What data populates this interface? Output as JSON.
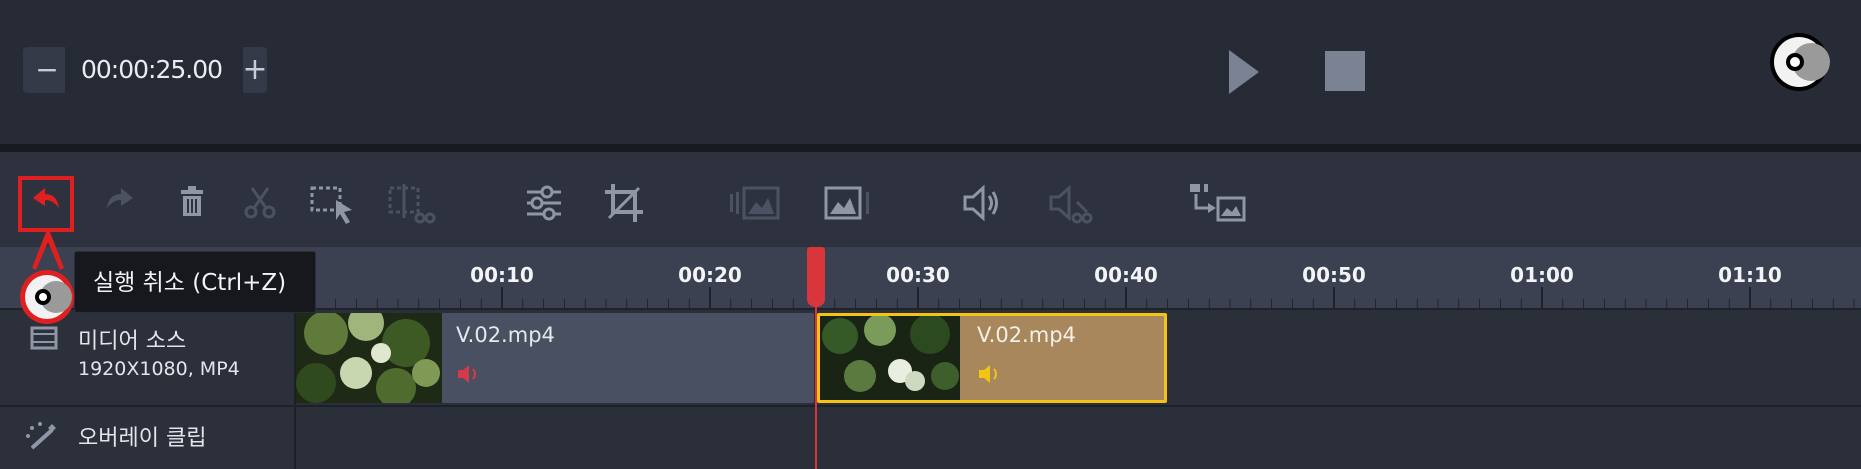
{
  "preview": {
    "time_value": "00:00:25.00",
    "minus_label": "−",
    "plus_label": "+"
  },
  "toolbar": {
    "undo_tooltip": "실행 취소 (Ctrl+Z)"
  },
  "ruler": {
    "ticks": [
      "00:10",
      "00:20",
      "00:30",
      "00:40",
      "00:50",
      "01:00",
      "01:10"
    ]
  },
  "tracks": {
    "video": {
      "label": "미디어 소스",
      "sub": "1920X1080, MP4",
      "clips": [
        {
          "name": "V.02.mp4",
          "selected": false
        },
        {
          "name": "V.02.mp4",
          "selected": true
        }
      ]
    },
    "overlay": {
      "label": "오버레이 클립"
    }
  },
  "colors": {
    "accent_red": "#e02020",
    "playhead": "#d9353c",
    "selected_clip": "#a8875c",
    "selected_border": "#f3c316"
  }
}
